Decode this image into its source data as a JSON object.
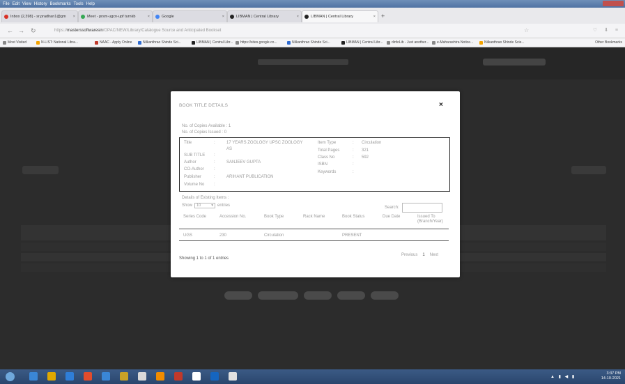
{
  "menubar": {
    "items": [
      "File",
      "Edit",
      "View",
      "History",
      "Bookmarks",
      "Tools",
      "Help"
    ]
  },
  "tabs": [
    {
      "label": "Inbox (2,398) - sr.pradhan1@gm",
      "color": "#d93025"
    },
    {
      "label": "Meet - prsm-ugcn-upf turnkb",
      "color": "#34a853"
    },
    {
      "label": "Google",
      "color": "#4285f4"
    },
    {
      "label": "LIBMAN | Central Library",
      "color": "#222222"
    },
    {
      "label": "LIBMAN | Central Library",
      "color": "#222222"
    }
  ],
  "newtab": "+",
  "nav": {
    "back": "←",
    "forward": "→",
    "reload": "↻",
    "url_prefix": "https://",
    "url_domain": "masterssoftwaresin",
    "url_rest": "/OPAC/NEW/Library/Catalogue Source and Anticipated Bookset",
    "star": "☆",
    "right_icons": "♡ ⬇ ≡"
  },
  "bookmarks": [
    {
      "label": "Most Visited",
      "color": "#888888"
    },
    {
      "label": "N-LIST: National Libra...",
      "color": "#f4a300"
    },
    {
      "label": "NAAC - Apply Online",
      "color": "#c0392b"
    },
    {
      "label": "Nilkanthrao Shinde Sci...",
      "color": "#2e6bd1"
    },
    {
      "label": "LIBMAN | Central Libr...",
      "color": "#222222"
    },
    {
      "label": "https://sites.google.co...",
      "color": "#888888"
    },
    {
      "label": "Nilkanthrao Shinde Sci...",
      "color": "#2e6bd1"
    },
    {
      "label": "LIBMAN | Central Libr...",
      "color": "#222222"
    },
    {
      "label": "dinfoLib - Just another...",
      "color": "#888888"
    },
    {
      "label": "e-Maharashtra Notice...",
      "color": "#888888"
    },
    {
      "label": "Nilkanthrao Shinde Scie...",
      "color": "#f4a300"
    }
  ],
  "other_bookmarks": "Other Bookmarks",
  "modal": {
    "title": "BOOK TITLE DETAILS",
    "close": "×",
    "copies_available": "No. of Copies Available : 1",
    "copies_issued": "No. of Copies Issued : 0",
    "fields_left": [
      {
        "label": "Title",
        "sep": ":",
        "value": "17 YEARS ZOOLOGY UPSC ZOOLOGY"
      },
      {
        "label": "",
        "sep": "",
        "value": "AS"
      },
      {
        "label": "SUB TITLE",
        "sep": ":",
        "value": ""
      },
      {
        "label": "Author",
        "sep": ":",
        "value": "SANJEEV GUPTA"
      },
      {
        "label": "CO-Author",
        "sep": ":",
        "value": ""
      },
      {
        "label": "Publisher",
        "sep": ":",
        "value": "ARIHANT PUBLICATION"
      },
      {
        "label": "Volume No",
        "sep": ":",
        "value": ""
      }
    ],
    "fields_right": [
      {
        "label": "Item Type",
        "sep": ":",
        "value": "Circulation"
      },
      {
        "label": "Total Pages",
        "sep": ":",
        "value": "321"
      },
      {
        "label": "Class No",
        "sep": ":",
        "value": "592"
      },
      {
        "label": "ISBN",
        "sep": ":",
        "value": ""
      },
      {
        "label": "Keywords",
        "sep": ":",
        "value": ""
      }
    ],
    "details_label": "Details of Existing Items :",
    "show_label": "Show",
    "show_value": "10",
    "entries_label": "entries",
    "search_label": "Search:",
    "table": {
      "headers": [
        "Series Code",
        "Accession No.",
        "Book Type",
        "Rack Name",
        "Book Status",
        "Due Date",
        "Issued To (Branch/Year)"
      ],
      "rows": [
        [
          "UGS",
          "230",
          "Circulation",
          "",
          "PRESENT",
          "",
          ""
        ]
      ]
    },
    "showing": "Showing 1 to 1 of 1 entries",
    "pager": {
      "previous": "Previous",
      "page": "1",
      "next": "Next"
    }
  },
  "taskbar": {
    "time": "3:37 PM",
    "date": "14-10-2021",
    "icon_colors": [
      "#3a86d6",
      "#e0a800",
      "#2f7ed8",
      "#e24c2c",
      "#3a86d6",
      "#c9a227",
      "#d9d9d9",
      "#f08c00",
      "#c0392b",
      "#ffffff",
      "#1565c0",
      "#e0e0e0",
      "#2f7ed8"
    ]
  }
}
